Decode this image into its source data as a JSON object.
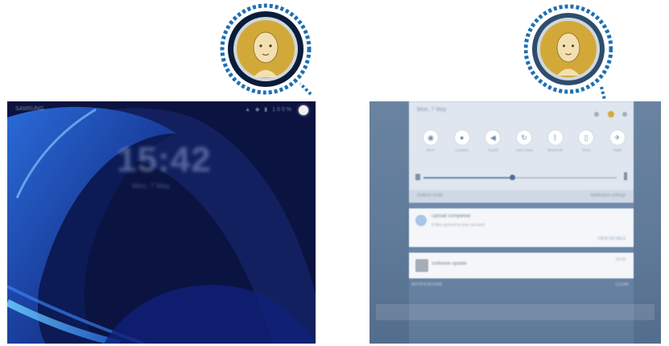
{
  "lock_screen": {
    "status_left": "SAMSUNG",
    "status_right": "▲ ◆ ▮ 100%",
    "clock": "15:42",
    "date": "Mon, 7 May"
  },
  "notification_panel": {
    "title": "Mon, 7 May",
    "quick_settings": [
      {
        "icon": "wifi-icon",
        "glyph": "◉",
        "label": "Wi-Fi"
      },
      {
        "icon": "location-icon",
        "glyph": "●",
        "label": "Location"
      },
      {
        "icon": "sound-icon",
        "glyph": "◀",
        "label": "Sound"
      },
      {
        "icon": "rotate-icon",
        "glyph": "↻",
        "label": "Auto rotate"
      },
      {
        "icon": "bluetooth-icon",
        "glyph": "ᛒ",
        "label": "Bluetooth"
      },
      {
        "icon": "flashlight-icon",
        "glyph": "▯",
        "label": "Torch"
      },
      {
        "icon": "airplane-icon",
        "glyph": "✈",
        "label": "Flight"
      }
    ],
    "footer_left": "Outdoor mode",
    "footer_right": "Notification settings",
    "notifications": [
      {
        "title": "Upload completed",
        "subtitle": "5 files synced to your account",
        "action": "VIEW DETAILS",
        "time": ""
      },
      {
        "title": "Software update",
        "subtitle": "",
        "action": "",
        "time": "15:40"
      }
    ],
    "below_left": "NOTIFICATIONS",
    "below_right": "CLEAR"
  },
  "colors": {
    "callout_dots": "#1f6fb0",
    "avatar_gold": "#d2a939",
    "lock_bg": "#0e1848",
    "panel_bg": "#7893b1"
  }
}
